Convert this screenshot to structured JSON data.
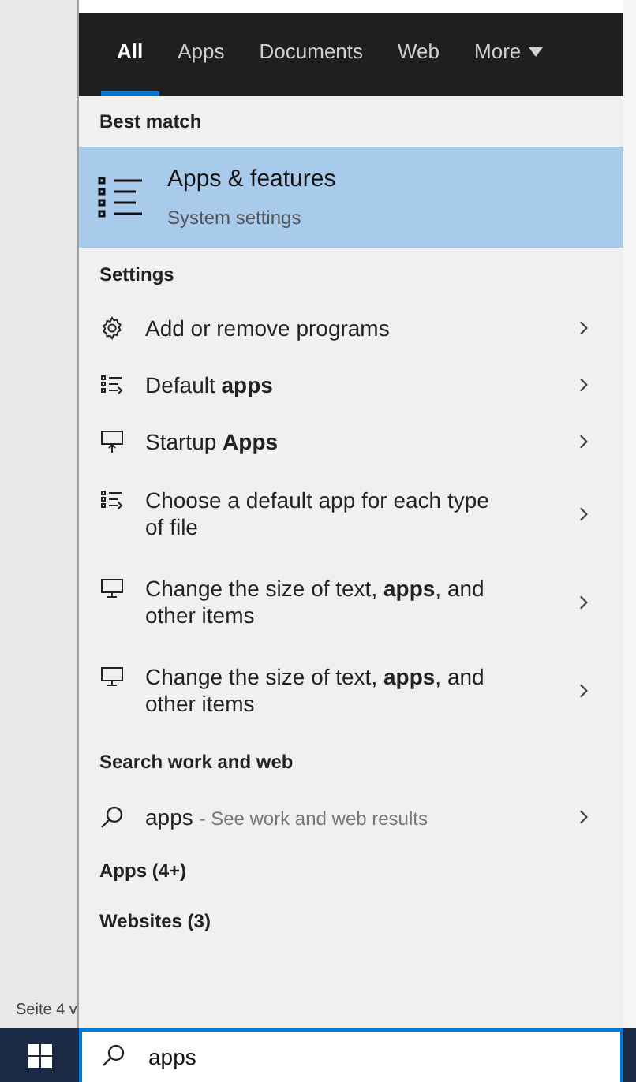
{
  "tabs": [
    {
      "label": "All",
      "selected": true
    },
    {
      "label": "Apps",
      "selected": false
    },
    {
      "label": "Documents",
      "selected": false
    },
    {
      "label": "Web",
      "selected": false
    },
    {
      "label": "More",
      "selected": false,
      "dropdown": true
    }
  ],
  "best_match": {
    "header": "Best match",
    "title": "Apps & features",
    "subtitle": "System settings",
    "selected": true
  },
  "settings": {
    "header": "Settings",
    "items": [
      {
        "kind": "gear",
        "text": "Add or remove programs"
      },
      {
        "kind": "list",
        "text": "Default **apps**"
      },
      {
        "kind": "startup",
        "text": "Startup **Apps**"
      },
      {
        "kind": "list",
        "text": "Choose a default app for each type of file"
      },
      {
        "kind": "display",
        "text": "Change the size of text, **apps**, and other items"
      },
      {
        "kind": "display",
        "text": "Change the size of text, **apps**, and other items"
      }
    ]
  },
  "web_search": {
    "header": "Search work and web",
    "query": "apps",
    "hint": "- See work and web results"
  },
  "groups": [
    "Apps (4+)",
    "Websites (3)"
  ],
  "background_status": "Seite 4 v",
  "search_box": {
    "value": "apps"
  }
}
